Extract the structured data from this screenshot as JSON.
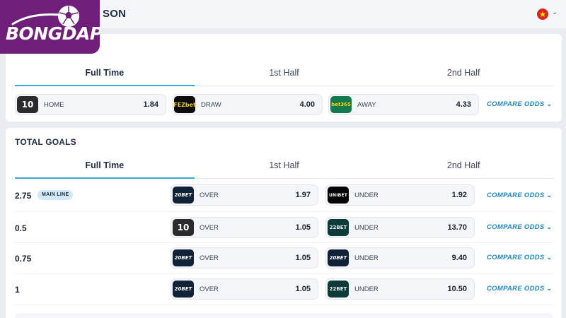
{
  "header": {
    "title_fragment": "SON",
    "flag_icon": "vietnam-flag-icon",
    "brand_color": "#6f1f79",
    "accent_color": "#3aa7d9"
  },
  "logo": {
    "text": "BONGDAPI"
  },
  "full_time_result": {
    "tabs": [
      "Full Time",
      "1st Half",
      "2nd Half"
    ],
    "active_tab": "Full Time",
    "odds": [
      {
        "bookmaker": "10",
        "label": "HOME",
        "value": "1.84"
      },
      {
        "bookmaker": "FEZbet",
        "label": "DRAW",
        "value": "4.00"
      },
      {
        "bookmaker": "bet365",
        "label": "AWAY",
        "value": "4.33"
      }
    ],
    "compare_label": "COMPARE ODDS"
  },
  "total_goals": {
    "title": "TOTAL GOALS",
    "tabs": [
      "Full Time",
      "1st Half",
      "2nd Half"
    ],
    "active_tab": "Full Time",
    "main_line_badge": "MAIN LINE",
    "compare_label": "COMPARE ODDS",
    "rows": [
      {
        "line": "2.75",
        "over_book": "20BET",
        "over_label": "OVER",
        "over_value": "1.97",
        "under_book": "UNIBET",
        "under_label": "UNDER",
        "under_value": "1.92"
      },
      {
        "line": "0.5",
        "over_book": "10",
        "over_label": "OVER",
        "over_value": "1.05",
        "under_book": "22BET",
        "under_label": "UNDER",
        "under_value": "13.70"
      },
      {
        "line": "0.75",
        "over_book": "20BET",
        "over_label": "OVER",
        "over_value": "1.05",
        "under_book": "20BET",
        "under_label": "UNDER",
        "under_value": "9.40"
      },
      {
        "line": "1",
        "over_book": "20BET",
        "over_label": "OVER",
        "over_value": "1.05",
        "under_book": "22BET",
        "under_label": "UNDER",
        "under_value": "10.50"
      }
    ]
  }
}
